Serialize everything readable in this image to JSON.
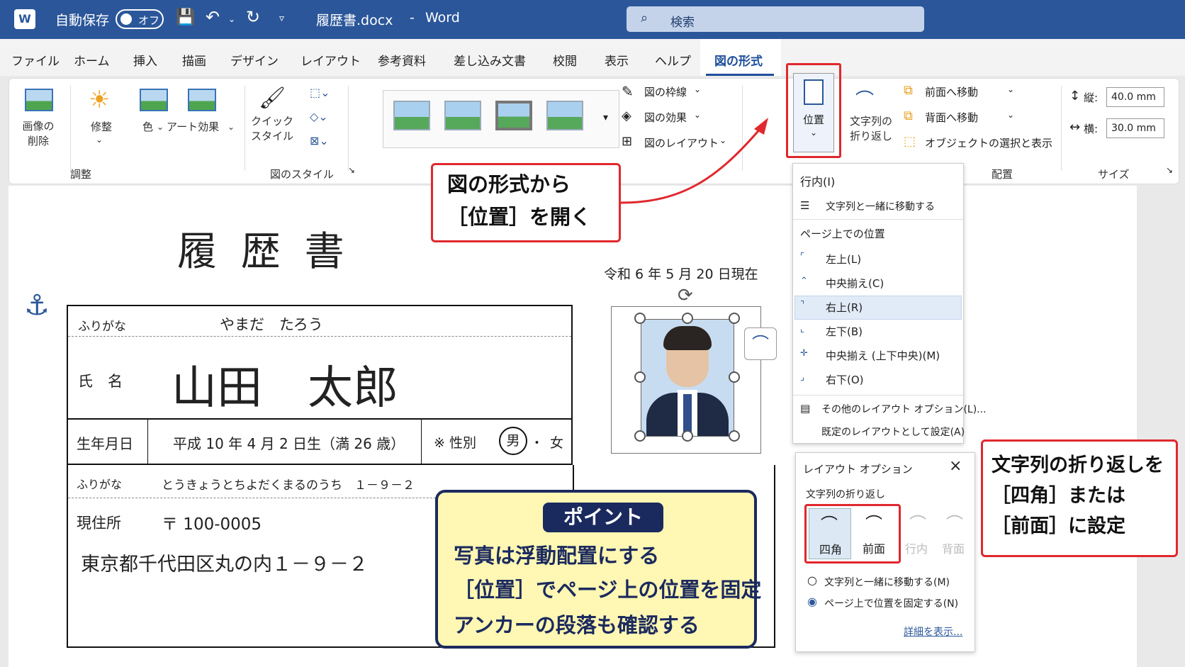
{
  "titlebar": {
    "autosave_label": "自動保存",
    "autosave_state": "オフ",
    "filename": "履歴書.docx",
    "separator": "-",
    "app_name": "Word",
    "search_placeholder": "検索"
  },
  "tabs": [
    "ファイル",
    "ホーム",
    "挿入",
    "描画",
    "デザイン",
    "レイアウト",
    "参考資料",
    "差し込み文書",
    "校閲",
    "表示",
    "ヘルプ",
    "図の形式"
  ],
  "ribbon": {
    "adjust": {
      "remove_bg": "画像の\n削除",
      "corrections": "修整",
      "color": "色",
      "artistic": "アート効果",
      "group": "調整"
    },
    "styles": {
      "quick": "クイック\nスタイル",
      "group": "図のスタイル",
      "border": "図の枠線",
      "effects": "図の効果",
      "layout": "図のレイアウト"
    },
    "arrange": {
      "position": "位置",
      "wrap": "文字列の\n折り返し",
      "forward": "前面へ移動",
      "backward": "背面へ移動",
      "selection": "オブジェクトの選択と表示",
      "group": "配置"
    },
    "size": {
      "height_label": "縦:",
      "height_value": "40.0 mm",
      "width_label": "横:",
      "width_value": "30.0 mm",
      "group": "サイズ"
    }
  },
  "position_menu": {
    "inline_header": "行内(I)",
    "inline_item": "文字列と一緒に移動する",
    "page_header": "ページ上での位置",
    "items": [
      "左上(L)",
      "中央揃え(C)",
      "右上(R)",
      "左下(B)",
      "中央揃え (上下中央)(M)",
      "右下(O)"
    ],
    "more": "その他のレイアウト オプション(L)...",
    "default": "既定のレイアウトとして設定(A)"
  },
  "layout_options": {
    "title": "レイアウト オプション",
    "wrap_label": "文字列の折り返し",
    "options": [
      "四角",
      "前面",
      "行内",
      "背面"
    ],
    "radio1": "文字列と一緒に移動する(M)",
    "radio2": "ページ上で位置を固定する(N)",
    "details": "詳細を表示..."
  },
  "callouts": {
    "open_position": "図の形式から\n［位置］を開く",
    "wrap_setting": "文字列の折り返しを\n［四角］または\n［前面］に設定"
  },
  "point": {
    "title": "ポイント",
    "lines": [
      "写真は浮動配置にする",
      "［位置］でページ上の位置を固定",
      "アンカーの段落も確認する"
    ]
  },
  "resume": {
    "title": "履 歴 書",
    "date": "令和 6 年 5 月 20 日現在",
    "furigana_label": "ふりがな",
    "furigana_name": "やまだ　たろう",
    "name_label": "氏　名",
    "name": "山田　太郎",
    "birth_label": "生年月日",
    "birth": "平成 10 年 4 月 2 日生（満 26 歳）",
    "gender_label": "※ 性別",
    "gender_m": "男",
    "gender_dot": "・",
    "gender_f": "女",
    "addr_furigana_label": "ふりがな",
    "addr_furigana": "とうきょうとちよだくまるのうち　１－９－２",
    "address_label": "現住所",
    "postal": "〒 100-0005",
    "address": "東京都千代田区丸の内１－９－２"
  }
}
